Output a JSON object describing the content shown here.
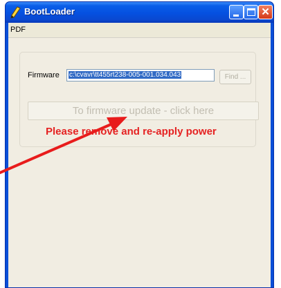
{
  "window": {
    "title": "BootLoader"
  },
  "menu": {
    "items": [
      "PDF"
    ]
  },
  "firmware": {
    "label": "Firmware",
    "value": "c:\\cvavr\\tt455rt238-005-001.034.043",
    "find_label": "Find ..."
  },
  "update_button": {
    "label": "To firmware update - click here"
  },
  "message": {
    "text": "Please remove and re-apply power",
    "color": "#e52222"
  },
  "colors": {
    "titlebar": "#0550e0",
    "client": "#f1ede2",
    "arrow": "#e81c1c"
  },
  "icons": {
    "app": "pencil-icon",
    "minimize": "minimize-icon",
    "maximize": "maximize-icon",
    "close": "close-icon",
    "annotation": "arrow-annotation"
  }
}
